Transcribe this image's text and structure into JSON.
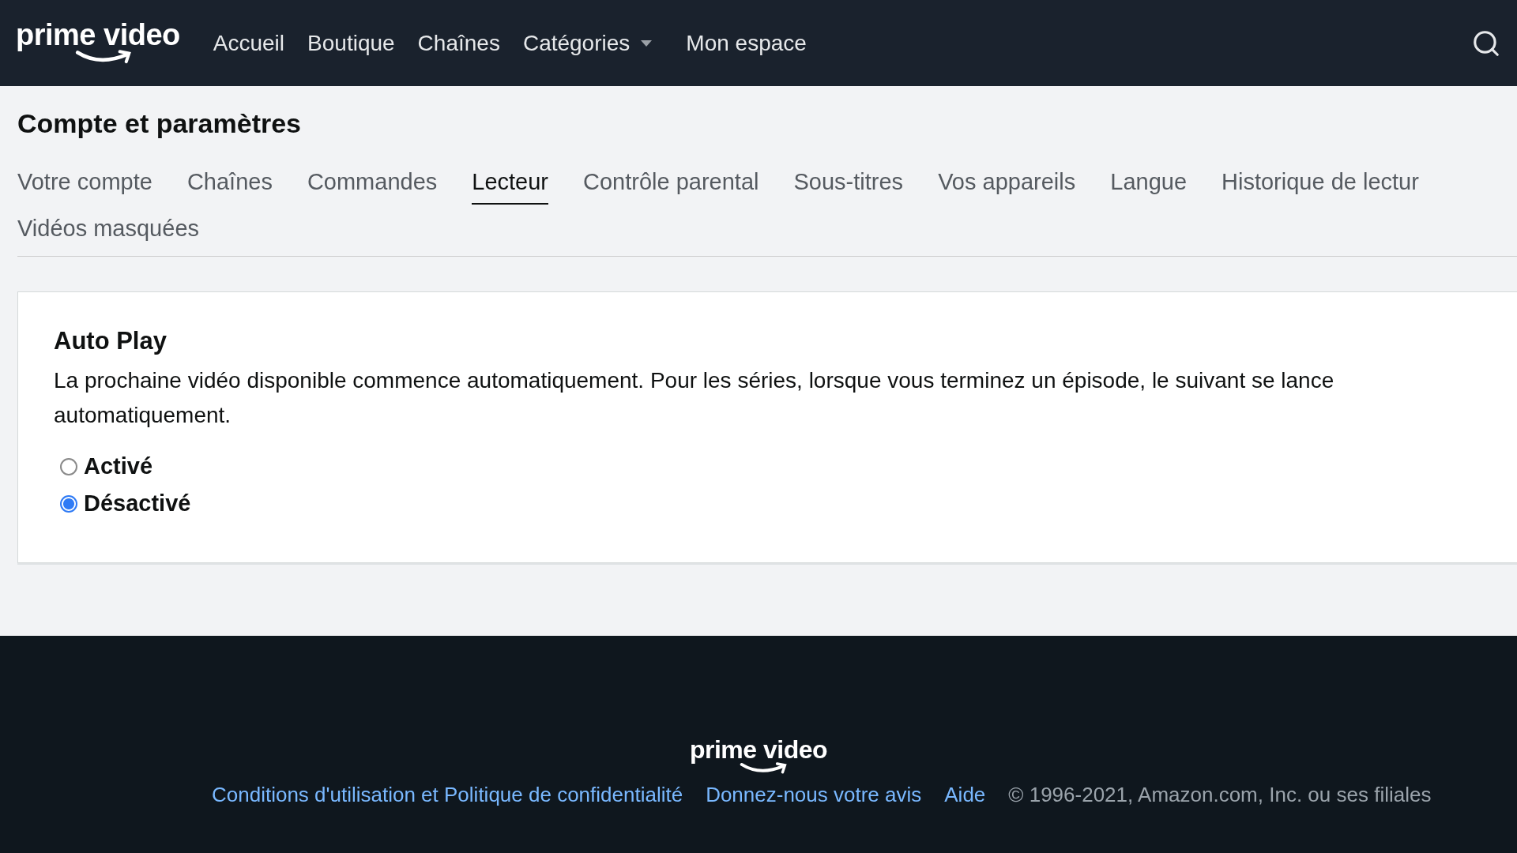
{
  "header": {
    "logo": "prime video",
    "nav": [
      {
        "label": "Accueil",
        "dropdown": false
      },
      {
        "label": "Boutique",
        "dropdown": false
      },
      {
        "label": "Chaînes",
        "dropdown": false
      },
      {
        "label": "Catégories",
        "dropdown": true
      },
      {
        "label": "Mon espace",
        "dropdown": false
      }
    ]
  },
  "page_title": "Compte et paramètres",
  "tabs": [
    {
      "label": "Votre compte",
      "selected": false
    },
    {
      "label": "Chaînes",
      "selected": false
    },
    {
      "label": "Commandes",
      "selected": false
    },
    {
      "label": "Lecteur",
      "selected": true
    },
    {
      "label": "Contrôle parental",
      "selected": false
    },
    {
      "label": "Sous-titres",
      "selected": false
    },
    {
      "label": "Vos appareils",
      "selected": false
    },
    {
      "label": "Langue",
      "selected": false
    },
    {
      "label": "Historique de lectur",
      "selected": false
    },
    {
      "label": "Vidéos masquées",
      "selected": false
    }
  ],
  "setting": {
    "title": "Auto Play",
    "description": "La prochaine vidéo disponible commence automatiquement. Pour les séries, lorsque vous terminez un épisode, le suivant se lance automatiquement.",
    "options": [
      {
        "label": "Activé",
        "selected": false
      },
      {
        "label": "Désactivé",
        "selected": true
      }
    ]
  },
  "footer": {
    "logo": "prime video",
    "links": [
      "Conditions d'utilisation et Politique de confidentialité",
      "Donnez-nous votre avis",
      "Aide"
    ],
    "copyright": "© 1996-2021, Amazon.com, Inc. ou ses filiales"
  }
}
